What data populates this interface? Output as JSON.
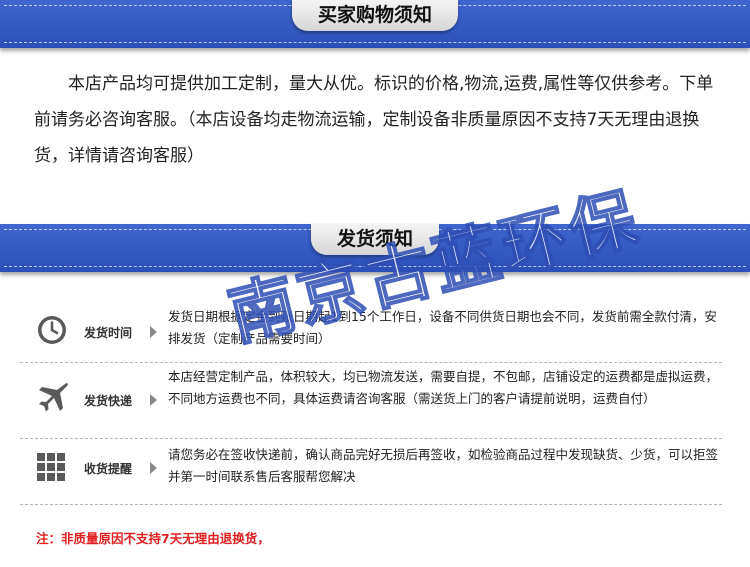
{
  "sections": {
    "notice_title": "买家购物须知",
    "notice_text": "本店产品均可提供加工定制，量大从优。标识的价格,物流,运费,属性等仅供参考。下单前请务必咨询客服。（本店设备均走物流运输，定制设备非质量原因不支持7天无理由退换货，详情请咨询客服）",
    "shipping_title": "发货须知"
  },
  "shipping_rows": [
    {
      "icon": "clock-icon",
      "label": "发货时间",
      "text": "发货日期根据定金到账日期起1到15个工作日，设备不同供货日期也会不同，发货前需全款付清，安排发货（定制产品需要时间）"
    },
    {
      "icon": "airplane-icon",
      "label": "发货快递",
      "text": "本店经营定制产品，体积较大，均已物流发送，需要自提，不包邮，店铺设定的运费都是虚拟运费，不同地方运费也不同，具体运费请咨询客服（需送货上门的客户请提前说明，运费自付）"
    },
    {
      "icon": "grid-icon",
      "label": "收货提醒",
      "text": "请您务必在签收快递前，确认商品完好无损后再签收，如检验商品过程中发现缺货、少货，可以拒签并第一时间联系售后客服帮您解决"
    }
  ],
  "note": "注：非质量原因不支持7天无理由退换货，",
  "watermark": "南京古蓝环保",
  "colors": {
    "banner": "#3358c4",
    "note": "#e02020",
    "icon": "#5a5a5a"
  }
}
